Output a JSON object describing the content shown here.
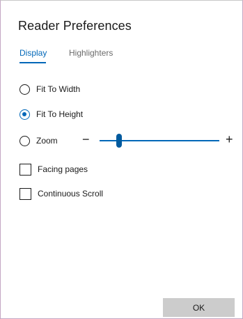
{
  "dialog": {
    "title": "Reader Preferences"
  },
  "tabs": [
    {
      "label": "Display",
      "active": true
    },
    {
      "label": "Highlighters",
      "active": false
    }
  ],
  "view_mode": {
    "options": [
      {
        "label": "Fit To Width",
        "selected": false
      },
      {
        "label": "Fit To Height",
        "selected": true
      },
      {
        "label": "Zoom",
        "selected": false
      }
    ]
  },
  "zoom": {
    "minus_label": "−",
    "plus_label": "+",
    "slider_level": 0.16
  },
  "checkboxes": [
    {
      "label": "Facing pages",
      "checked": false
    },
    {
      "label": "Continuous Scroll",
      "checked": false
    }
  ],
  "footer": {
    "ok_label": "OK"
  },
  "colors": {
    "accent": "#0067b8",
    "button_bg": "#cccccc",
    "text": "#1a1a1a",
    "inactive_tab": "#6b6b6b"
  }
}
